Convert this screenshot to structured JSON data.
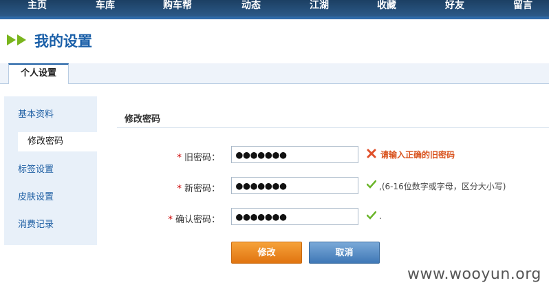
{
  "topnav": {
    "items": [
      "主页",
      "车库",
      "购车帮",
      "动态",
      "江湖",
      "收藏",
      "好友",
      "留言"
    ]
  },
  "page": {
    "title": "我的设置",
    "tab_active": "个人设置"
  },
  "sidebar": {
    "items": [
      {
        "label": "基本资料",
        "active": false
      },
      {
        "label": "修改密码",
        "active": true
      },
      {
        "label": "标签设置",
        "active": false
      },
      {
        "label": "皮肤设置",
        "active": false
      },
      {
        "label": "消费记录",
        "active": false
      }
    ]
  },
  "form": {
    "section_title": "修改密码",
    "required_mark": "*",
    "old_password": {
      "label": "旧密码：",
      "value": "●●●●●●●",
      "error": "请输入正确的旧密码"
    },
    "new_password": {
      "label": "新密码：",
      "value": "●●●●●●●",
      "hint": ",(6-16位数字或字母，区分大小写)"
    },
    "confirm_password": {
      "label": "确认密码：",
      "value": "●●●●●●●",
      "hint": "."
    },
    "save_label": "修改",
    "cancel_label": "取消"
  },
  "colors": {
    "nav_bg": "#1c3f63",
    "title_blue": "#1a5fa8",
    "arrow_green": "#7ab51d",
    "error_orange": "#d9531e",
    "ok_green": "#6bb52a",
    "save_orange": "#ee8a20",
    "cancel_blue": "#4f85c0"
  },
  "watermark": "www.wooyun.org"
}
